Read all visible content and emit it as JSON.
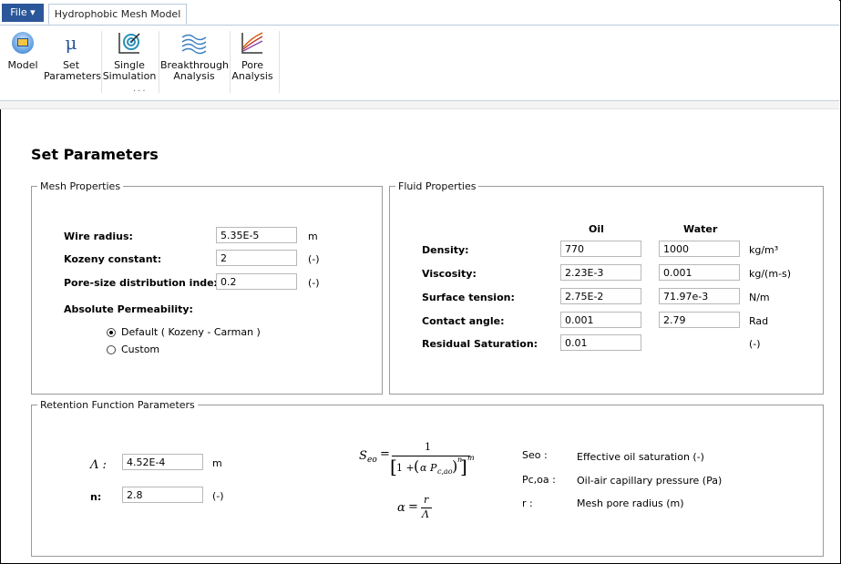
{
  "ribbon": {
    "file_label": "File ▾",
    "doc_tab": "Hydrophobic Mesh Model",
    "buttons": [
      {
        "label": "Model",
        "icon": "model-icon"
      },
      {
        "label": "Set\nParameters",
        "icon": "mu-icon"
      },
      {
        "label": "Single\nSimulation",
        "icon": "target-icon"
      },
      {
        "label": "Breakthrough\nAnalysis",
        "icon": "waves-icon"
      },
      {
        "label": "Pore\nAnalysis",
        "icon": "curves-icon"
      }
    ],
    "more": "···"
  },
  "page_title": "Set Parameters",
  "mesh": {
    "legend": "Mesh Properties",
    "wire_radius": {
      "label": "Wire radius:",
      "value": "5.35E-5",
      "unit": "m"
    },
    "kozeny": {
      "label": "Kozeny constant:",
      "value": "2",
      "unit": "(-)"
    },
    "psd": {
      "label": "Pore-size distribution index:",
      "value": "0.2",
      "unit": "(-)"
    },
    "perm_label": "Absolute Permeability:",
    "perm_options": [
      {
        "label": "Default ( Kozeny - Carman )",
        "selected": true
      },
      {
        "label": "Custom",
        "selected": false
      }
    ]
  },
  "fluid": {
    "legend": "Fluid Properties",
    "col_oil": "Oil",
    "col_water": "Water",
    "rows": [
      {
        "label": "Density:",
        "oil": "770",
        "water": "1000",
        "unit": "kg/m³"
      },
      {
        "label": "Viscosity:",
        "oil": "2.23E-3",
        "water": "0.001",
        "unit": "kg/(m-s)"
      },
      {
        "label": "Surface tension:",
        "oil": "2.75E-2",
        "water": "71.97e-3",
        "unit": "N/m"
      },
      {
        "label": "Contact angle:",
        "oil": "0.001",
        "water": "2.79",
        "unit": "Rad"
      },
      {
        "label": "Residual Saturation:",
        "oil": "0.01",
        "water": null,
        "unit": "(-)"
      }
    ]
  },
  "retention": {
    "legend": "Retention Function Parameters",
    "lambda": {
      "label": "Λ :",
      "value": "4.52E-4",
      "unit": "m"
    },
    "n": {
      "label": "n:",
      "value": "2.8",
      "unit": "(-)"
    },
    "eq1_lhs": "S",
    "eq1_lhs_sub": "eo",
    "eq1_eq": "=",
    "eq1_num": "1",
    "eq1_den_one": "1 + ",
    "eq1_alpha": "α",
    "eq1_p": "P",
    "eq1_p_sub": "c,ao",
    "eq1_n": "n",
    "eq1_m": "m",
    "eq2_lhs": "α",
    "eq2_eq": "=",
    "eq2_num": "r",
    "eq2_den": "Λ",
    "legend_items": [
      {
        "key": "Seo :",
        "desc": "Effective oil saturation (-)"
      },
      {
        "key": "Pc,oa :",
        "desc": "Oil-air capillary pressure (Pa)"
      },
      {
        "key": "r :",
        "desc": "Mesh pore radius (m)"
      }
    ]
  }
}
